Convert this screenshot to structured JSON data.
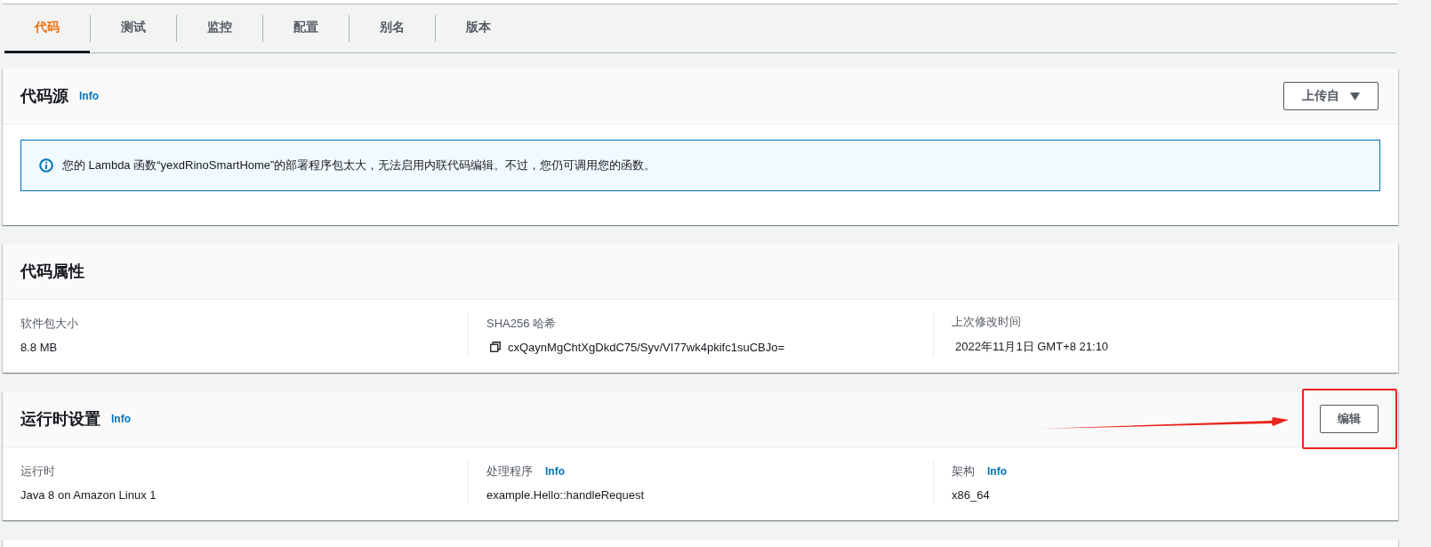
{
  "tabs": [
    {
      "label": "代码",
      "selected": true
    },
    {
      "label": "测试",
      "selected": false
    },
    {
      "label": "监控",
      "selected": false
    },
    {
      "label": "配置",
      "selected": false
    },
    {
      "label": "别名",
      "selected": false
    },
    {
      "label": "版本",
      "selected": false
    }
  ],
  "code_source": {
    "title": "代码源",
    "info": "Info",
    "upload_button": "上传自",
    "alert": "您的 Lambda 函数“yexdRinoSmartHome”的部署程序包太大，无法启用内联代码编辑。不过，您仍可调用您的函数。"
  },
  "code_properties": {
    "title": "代码属性",
    "fields": [
      {
        "label": "软件包大小",
        "value": "8.8 MB",
        "copyable": false
      },
      {
        "label": "SHA256 哈希",
        "value": "cxQaynMgChtXgDkdC75/Syv/VI77wk4pkifc1suCBJo=",
        "copyable": true
      },
      {
        "label": "上次修改时间",
        "value": "2022年11月1日 GMT+8 21:10",
        "copyable": false
      }
    ]
  },
  "runtime_settings": {
    "title": "运行时设置",
    "info": "Info",
    "edit_button": "编辑",
    "highlighted": true,
    "fields": [
      {
        "label": "运行时",
        "value": "Java 8 on Amazon Linux 1"
      },
      {
        "label": "处理程序",
        "info": "Info",
        "value": "example.Hello::handleRequest"
      },
      {
        "label": "架构",
        "info": "Info",
        "value": "x86_64"
      }
    ]
  }
}
